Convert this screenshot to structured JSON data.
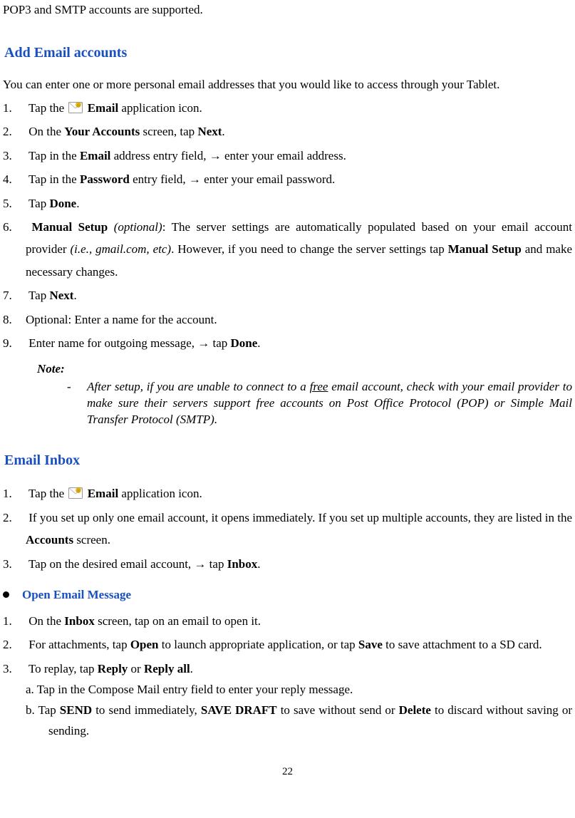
{
  "intro_line": "POP3 and SMTP accounts are supported.",
  "section1": {
    "title": "Add Email accounts",
    "intro": "You can enter one or more personal email addresses that you would like to access through your Tablet.",
    "steps": {
      "s1_a": "Tap the ",
      "s1_b": " application icon.",
      "s1_bold": "Email",
      "s2_a": "On the ",
      "s2_b": " screen, tap ",
      "s2_bold1": "Your Accounts",
      "s2_bold2": "Next",
      "s2_c": ".",
      "s3_a": "Tap in the ",
      "s3_bold": "Email",
      "s3_b": " address entry field,  →  enter your email address.",
      "s4_a": "Tap in the ",
      "s4_bold": "Password",
      "s4_b": " entry field,  →  enter your email password.",
      "s5_a": "Tap ",
      "s5_bold": "Done",
      "s5_b": ".",
      "s6_bold1": "Manual Setup",
      "s6_i1": " (optional)",
      "s6_a": ": The server settings are automatically populated based on your email account provider ",
      "s6_i2": "(i.e., gmail.com, etc)",
      "s6_b": ". However, if you need to change the server settings tap ",
      "s6_bold2": "Manual Setup",
      "s6_c": " and make necessary changes.",
      "s7_a": "Tap ",
      "s7_bold": "Next",
      "s7_b": ".",
      "s8": "Optional: Enter a name for the account.",
      "s9_a": "Enter name for outgoing message,  →  tap ",
      "s9_bold": "Done",
      "s9_b": "."
    },
    "note_label": "Note:",
    "note_dash": "-",
    "note_a": "After setup, if you are unable to connect to a ",
    "note_u": "free",
    "note_b": " email account, check with your email provider to make sure their servers support free accounts on Post Office Protocol (POP) or Simple Mail Transfer Protocol (SMTP)."
  },
  "section2": {
    "title": "Email Inbox",
    "steps": {
      "s1_a": "Tap the ",
      "s1_bold": "Email",
      "s1_b": " application icon.",
      "s2_a": "If you set up only one email account, it opens immediately. If you set up multiple accounts, they are listed in the ",
      "s2_bold": "Accounts",
      "s2_b": " screen.",
      "s3_a": "Tap on the desired email account,  →  tap ",
      "s3_bold": "Inbox",
      "s3_b": "."
    },
    "sub_title": "Open Email Message",
    "sub_steps": {
      "s1_a": "On the ",
      "s1_bold": "Inbox",
      "s1_b": " screen, tap on an email to open it.",
      "s2_a": "For attachments, tap ",
      "s2_bold1": "Open",
      "s2_b": " to launch appropriate application, or tap ",
      "s2_bold2": "Save",
      "s2_c": " to save attachment to a SD card.",
      "s3_a": "To replay, tap ",
      "s3_bold1": "Reply",
      "s3_b": " or ",
      "s3_bold2": "Reply all",
      "s3_c": ".",
      "a_line": "a. Tap in the Compose Mail entry field to enter your reply message.",
      "b_a": "b. Tap ",
      "b_bold1": "SEND",
      "b_b": " to send immediately, ",
      "b_bold2": "SAVE DRAFT",
      "b_c": " to save without send or ",
      "b_bold3": "Delete",
      "b_d": " to discard without saving or sending."
    }
  },
  "page_number": "22"
}
